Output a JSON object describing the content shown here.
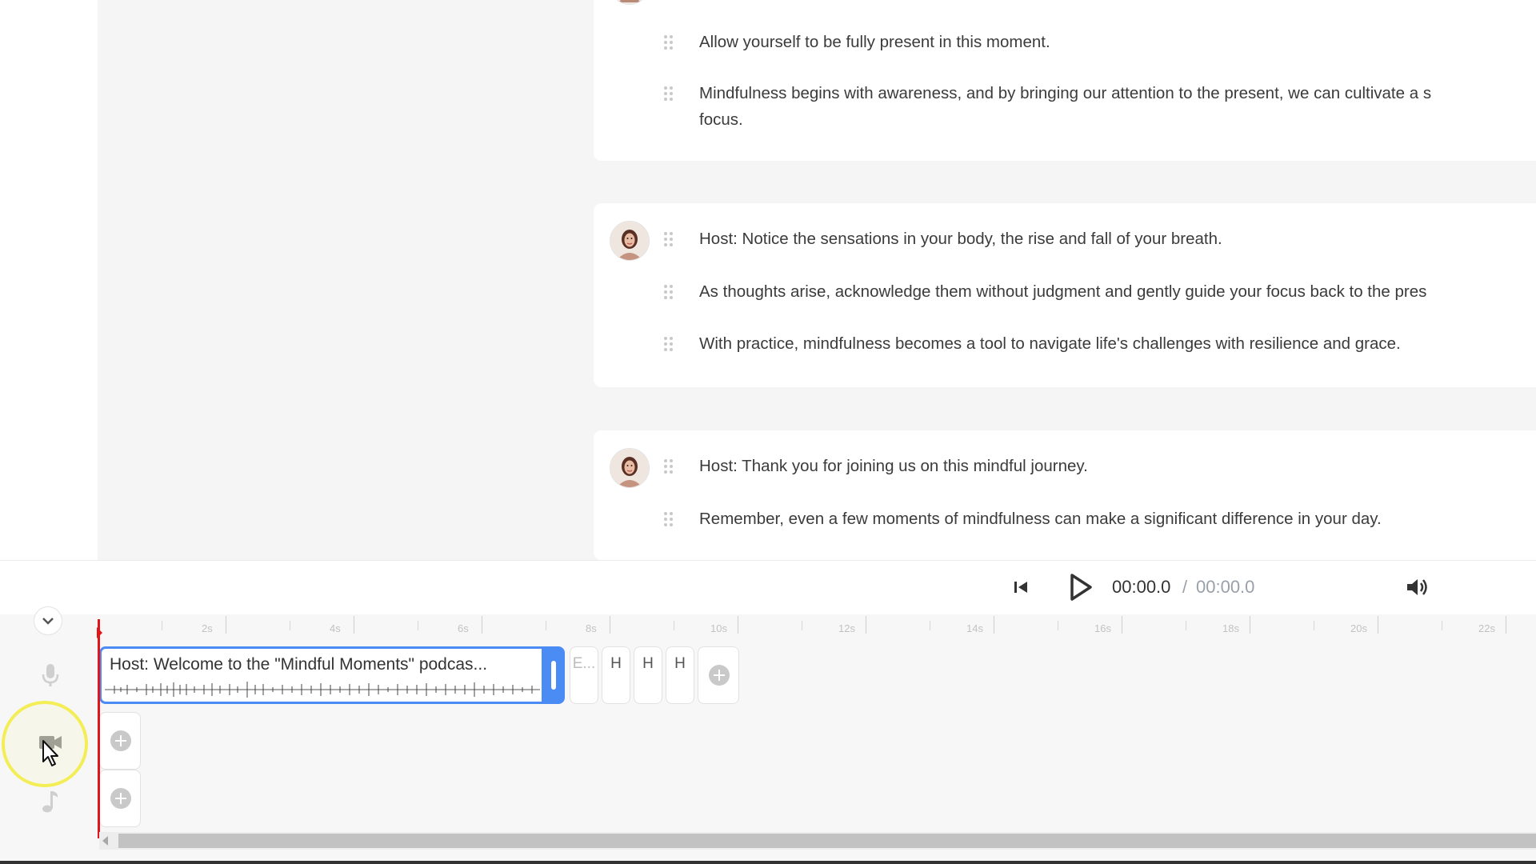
{
  "transcript": {
    "blocks": [
      {
        "has_avatar": false,
        "lines": [
          "Allow yourself to be fully present in this moment.",
          "Mindfulness begins with awareness, and by bringing our attention to the present, we can cultivate a s",
          "focus."
        ]
      },
      {
        "has_avatar": true,
        "lines": [
          "Host: Notice the sensations in your body, the rise and fall of your breath.",
          "As thoughts arise, acknowledge them without judgment and gently guide your focus back to the pres",
          "With practice, mindfulness becomes a tool to navigate life's challenges with resilience and grace."
        ]
      },
      {
        "has_avatar": true,
        "lines": [
          "Host: Thank you for joining us on this mindful journey.",
          "Remember, even a few moments of mindfulness can make a significant difference in your day."
        ]
      }
    ]
  },
  "player": {
    "current_time": "00:00.0",
    "separator": "/",
    "total_time": "00:00.0"
  },
  "timeline": {
    "ruler_labels": [
      "2s",
      "4s",
      "6s",
      "8s",
      "10s",
      "12s",
      "14s",
      "16s",
      "18s",
      "20s",
      "22s"
    ],
    "voice_track": {
      "main_clip_title": "Host: Welcome to the \"Mindful Moments\" podcas...",
      "mini_clips": [
        "E...",
        "H",
        "H",
        "H"
      ]
    },
    "playhead_color": "#e0161b",
    "selection_color": "#4a8cf4"
  },
  "icons": {
    "skip": "skip-to-start-icon",
    "play": "play-icon",
    "volume": "volume-icon",
    "collapse": "chevron-down-icon",
    "voice_track": "microphone-icon",
    "video_track": "video-camera-icon",
    "music_track": "music-note-icon",
    "add": "add-circle-icon"
  }
}
